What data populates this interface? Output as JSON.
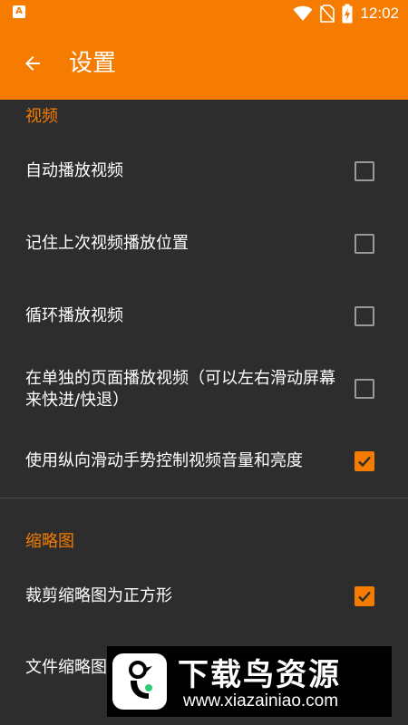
{
  "status_bar": {
    "app_icon_letter": "A",
    "time": "12:02",
    "icons": [
      "wifi-icon",
      "no-sim-icon",
      "battery-charging-icon"
    ]
  },
  "app_bar": {
    "title": "设置",
    "back_icon": "arrow-left-icon"
  },
  "sections": [
    {
      "title": "视频",
      "items": [
        {
          "label": "自动播放视频",
          "checked": false
        },
        {
          "label": "记住上次视频播放位置",
          "checked": false
        },
        {
          "label": "循环播放视频",
          "checked": false
        },
        {
          "label": "在单独的页面播放视频（可以左右滑动屏幕来快进/快退）",
          "checked": false
        },
        {
          "label": "使用纵向滑动手势控制视频音量和亮度",
          "checked": true
        }
      ]
    },
    {
      "title": "缩略图",
      "items": [
        {
          "label": "裁剪缩略图为正方形",
          "checked": true
        },
        {
          "label": "文件缩略图",
          "checked": false
        }
      ]
    }
  ],
  "watermark": {
    "title": "下载鸟资源",
    "url": "www.xiazainiao.com"
  },
  "colors": {
    "accent": "#f57c00",
    "background": "#2d2d2d",
    "checkbox_border": "#9a9a9a"
  }
}
